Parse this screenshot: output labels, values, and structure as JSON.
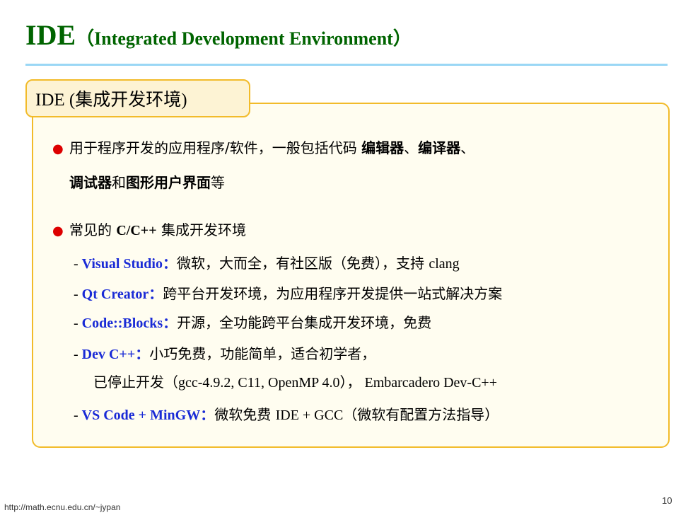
{
  "header": {
    "title_main": "IDE",
    "title_rest": "（Integrated Development Environment）"
  },
  "box": {
    "tab_en": "IDE (",
    "tab_cn": "集成开发环境",
    "tab_close": ")"
  },
  "bullets": [
    {
      "line1_a": "用于程序开发的应用程序/软件，一般包括代码 ",
      "line1_b1": "编辑器",
      "line1_sep": "、",
      "line1_b2": "编译器",
      "line1_end": "、",
      "line2_b1": "调试器",
      "line2_mid": "和",
      "line2_b2": "图形用户界面",
      "line2_end": "等"
    },
    {
      "text_a": "常见的 ",
      "text_b": "C/C++",
      "text_c": " 集成开发环境"
    }
  ],
  "ides": [
    {
      "dash": "- ",
      "name": "Visual Studio",
      "colon": "：",
      "desc": "微软，大而全，有社区版（免费），支持 ",
      "desc_en": "clang"
    },
    {
      "dash": "- ",
      "name": "Qt Creator",
      "colon": "：",
      "desc": "跨平台开发环境，为应用程序开发提供一站式解决方案"
    },
    {
      "dash": "- ",
      "name": "Code::Blocks",
      "colon": "：",
      "desc": "开源，全功能跨平台集成开发环境，免费"
    },
    {
      "dash": "- ",
      "name": "Dev C++",
      "colon": "：",
      "desc": "小巧免费，功能简单，适合初学者，",
      "desc2_a": "已停止开发（",
      "desc2_b": "gcc-4.9.2, C11, OpenMP 4.0",
      "desc2_c": "），",
      "desc2_d": " Embarcadero Dev-C++"
    },
    {
      "dash": "- ",
      "name": "VS Code + MinGW",
      "colon": "：",
      "desc": "微软免费 ",
      "desc_en": "IDE + GCC",
      "desc_tail": "（微软有配置方法指导）"
    }
  ],
  "footer": {
    "url": "http://math.ecnu.edu.cn/~jypan",
    "page": "10"
  }
}
